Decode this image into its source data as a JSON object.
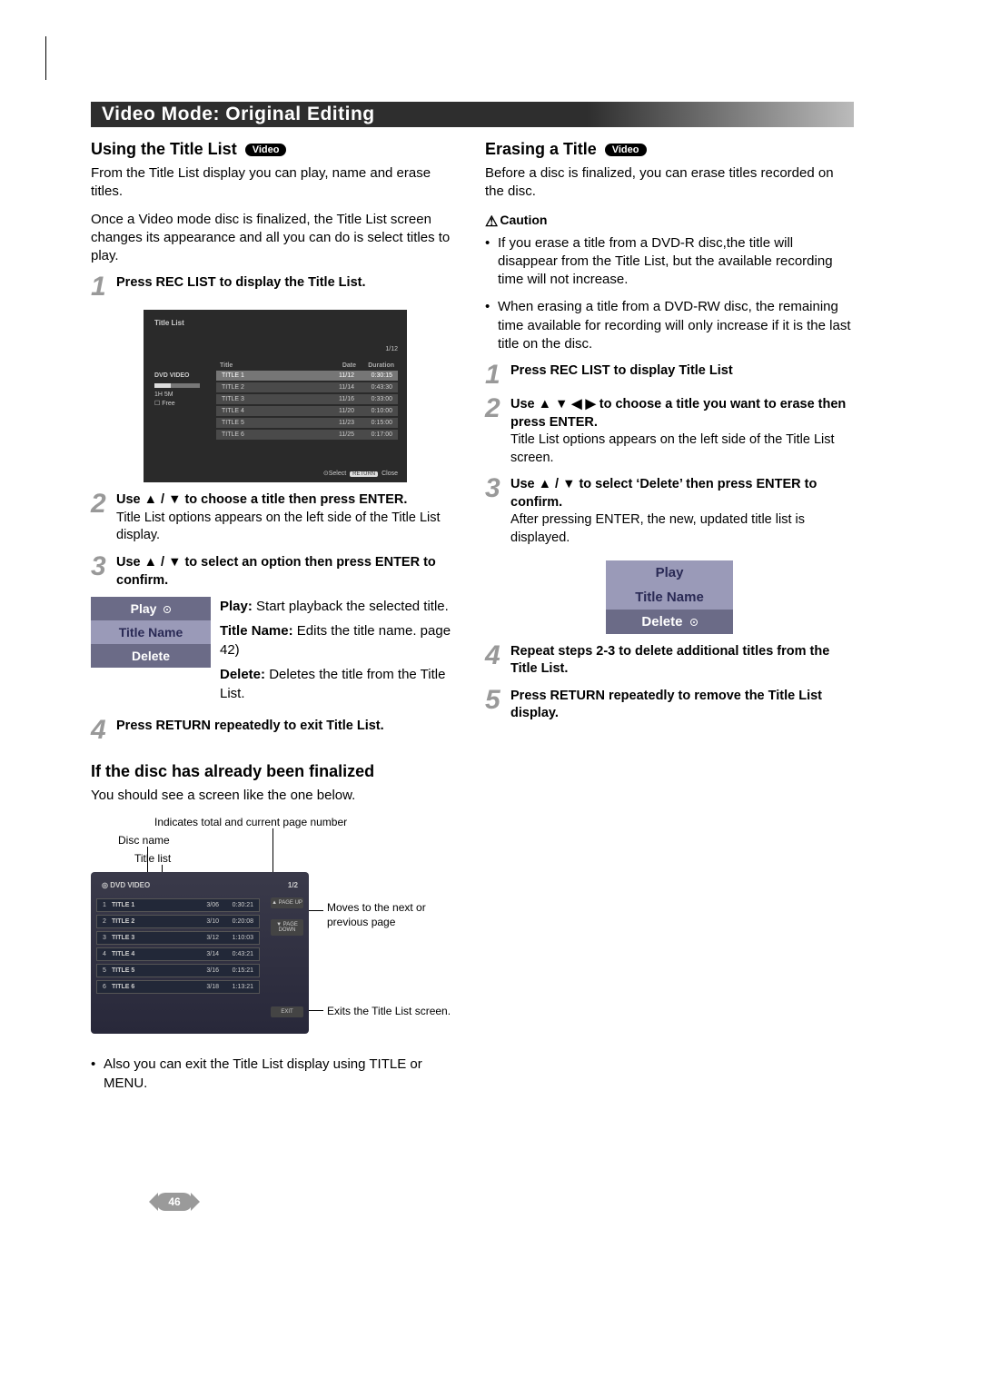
{
  "page_number": "46",
  "title_bar": "Video Mode: Original Editing",
  "left": {
    "h_using": "Using the Title List",
    "pill_video": "Video",
    "p1": "From the Title List display you can play, name and erase titles.",
    "p2": "Once a Video mode disc is finalized, the Title List screen changes its appearance and all you can do is select titles to play.",
    "step1": "Press REC LIST to display the Title List.",
    "shot1": {
      "label": "Title List",
      "page": "1/12",
      "side_disc": "DVD VIDEO",
      "side_time": "1H 5M",
      "side_free": "Free",
      "cols": [
        "Title",
        "Date",
        "Duration"
      ],
      "rows": [
        [
          "TITLE 1",
          "11/12",
          "0:30:15"
        ],
        [
          "TITLE 2",
          "11/14",
          "0:43:30"
        ],
        [
          "TITLE 3",
          "11/16",
          "0:33:00"
        ],
        [
          "TITLE 4",
          "11/20",
          "0:10:00"
        ],
        [
          "TITLE 5",
          "11/23",
          "0:15:00"
        ],
        [
          "TITLE 6",
          "11/25",
          "0:17:00"
        ]
      ],
      "foot_select": "Select",
      "foot_return": "RETURN",
      "foot_close": "Close"
    },
    "step2_b": "Use ▲ / ▼ to choose a title then press ENTER.",
    "step2_body": "Title List options appears on the left side of the Title List display.",
    "step3_b": "Use ▲ / ▼ to select an option then press ENTER to confirm.",
    "opt_play": "Play",
    "opt_titlename": "Title Name",
    "opt_delete": "Delete",
    "opt_play_d": " Start playback the selected title.",
    "opt_play_l": "Play:",
    "opt_tn_l": "Title Name:",
    "opt_tn_d": " Edits the title name. page 42)",
    "opt_del_l": "Delete:",
    "opt_del_d": " Deletes the title from the Title List.",
    "step4": "Press RETURN repeatedly to exit Title List.",
    "h_final": "If the disc has already been finalized",
    "p_final": "You should see a screen like the one below.",
    "lbl_pages": "Indicates total and current page number",
    "lbl_disc": "Disc name",
    "lbl_tl": "Title list",
    "shot2": {
      "disc": "DVD  VIDEO",
      "page": "1/2",
      "rows": [
        [
          "1",
          "TITLE 1",
          "3/06",
          "0:30:21"
        ],
        [
          "2",
          "TITLE 2",
          "3/10",
          "0:20:08"
        ],
        [
          "3",
          "TITLE 3",
          "3/12",
          "1:10:03"
        ],
        [
          "4",
          "TITLE 4",
          "3/14",
          "0:43:21"
        ],
        [
          "5",
          "TITLE 5",
          "3/16",
          "0:15:21"
        ],
        [
          "6",
          "TITLE 6",
          "3/18",
          "1:13:21"
        ]
      ],
      "pu": "▲ PAGE\nUP",
      "pd": "▼ PAGE\nDOWN",
      "ex": "EXIT"
    },
    "note_page": "Moves to the next or previous page",
    "note_exit": "Exits the Title List screen.",
    "bul_exit": "Also you can exit the Title List display using TITLE or MENU."
  },
  "right": {
    "h_erase": "Erasing a Title",
    "p1": "Before a disc is finalized, you can erase titles recorded on the disc.",
    "caution": "Caution",
    "c1": "If you erase a title from a DVD-R disc,the title will disappear from the Title List, but the available recording time will not increase.",
    "c2": "When erasing a title from a DVD-RW disc, the remaining time available for recording will only increase if it is the last title on the disc.",
    "step1": "Press REC LIST to display Title List",
    "step2_b": "Use ▲ ▼ ◀ ▶ to choose a title you want to erase then press ENTER.",
    "step2_body": "Title List options appears on the left side of the Title List screen.",
    "step3_b": "Use ▲ / ▼ to select ‘Delete’ then press ENTER to confirm.",
    "step3_body": "After pressing ENTER, the new, updated title list is displayed.",
    "m1": "Play",
    "m2": "Title Name",
    "m3": "Delete",
    "step4": "Repeat steps 2-3 to delete additional titles from the Title List.",
    "step5": "Press RETURN repeatedly to remove the Title List display."
  }
}
